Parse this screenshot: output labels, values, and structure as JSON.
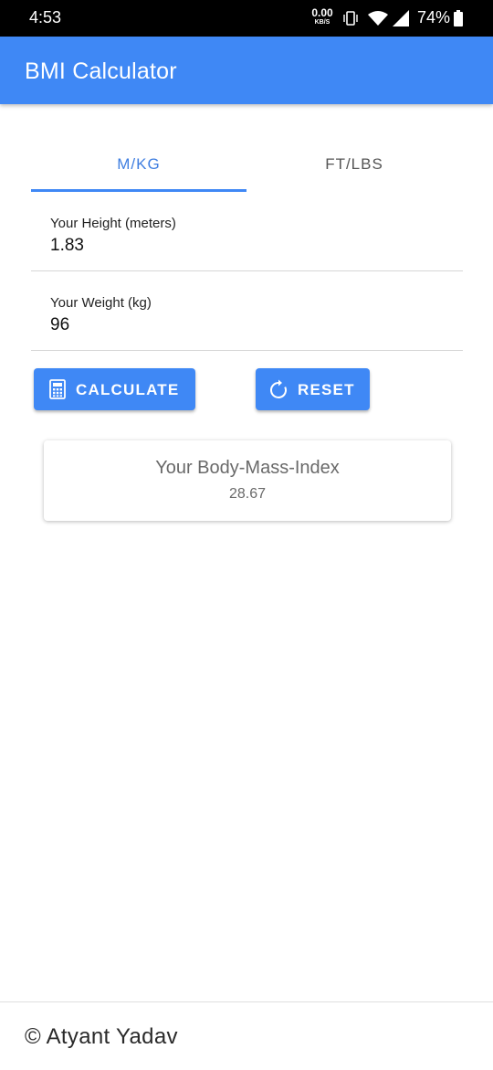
{
  "status_bar": {
    "time": "4:53",
    "net_speed_value": "0.00",
    "net_speed_unit": "KB/S",
    "battery_percent": "74%",
    "icons": [
      "vibrate-icon",
      "wifi-icon",
      "cell-signal-icon",
      "battery-icon"
    ]
  },
  "app_bar": {
    "title": "BMI Calculator",
    "color": "#3f88f5"
  },
  "tabs": [
    {
      "label": "M/KG",
      "selected": true
    },
    {
      "label": "FT/LBS",
      "selected": false
    }
  ],
  "form": {
    "height_label": "Your Height (meters)",
    "height_value": "1.83",
    "weight_label": "Your Weight (kg)",
    "weight_value": "96"
  },
  "buttons": {
    "calculate_label": "CALCULATE",
    "calculate_icon": "calculator-icon",
    "reset_label": "RESET",
    "reset_icon": "refresh-icon"
  },
  "result": {
    "title": "Your Body-Mass-Index",
    "value": "28.67"
  },
  "footer": {
    "text": "© Atyant Yadav"
  }
}
